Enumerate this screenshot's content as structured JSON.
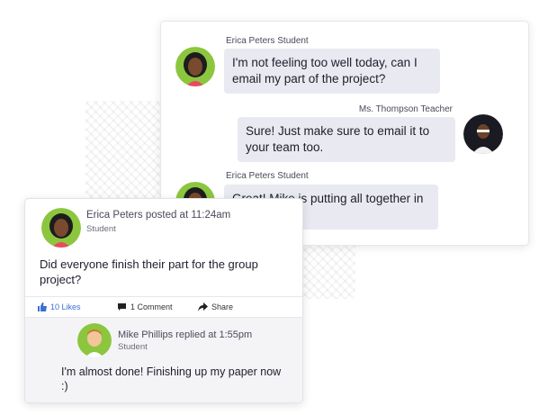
{
  "chat": {
    "messages": [
      {
        "sender": "Erica Peters Student",
        "text": "I'm not feeling too well today, can I email my part of the project?"
      },
      {
        "sender": "Ms. Thompson Teacher",
        "text": "Sure! Just make sure to email it to your team too."
      },
      {
        "sender": "Erica Peters Student",
        "text": "Great! Mike is putting all together in a to hand in."
      }
    ]
  },
  "post": {
    "author_line": "Erica Peters posted at 11:24am",
    "role": "Student",
    "text": "Did everyone finish their part for the group project?",
    "actions": {
      "likes": "10 Likes",
      "comments": "1 Comment",
      "share": "Share"
    },
    "reply": {
      "author_line": "Mike Phillips replied at 1:55pm",
      "role": "Student",
      "text": "I'm almost done! Finishing up my paper now :)"
    }
  },
  "colors": {
    "like_blue": "#3b6fd6",
    "avatar_green": "#8cc63f"
  },
  "icons": [
    "thumbs-up-icon",
    "comment-icon",
    "share-icon"
  ]
}
